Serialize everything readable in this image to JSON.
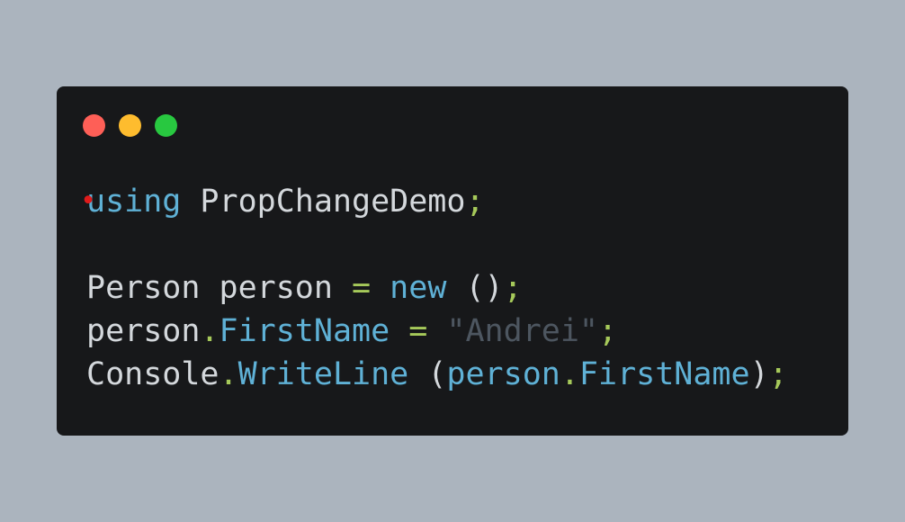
{
  "colors": {
    "background": "#abb4be",
    "window": "#17181a",
    "close": "#fe5f57",
    "minimize": "#febc2e",
    "maximize": "#28c840",
    "plain": "#d4d8dc",
    "keyword": "#5fb1d6",
    "member": "#5fb1d6",
    "punctuation": "#a6c95a",
    "string": "#4d5660",
    "error_marker": "#e01b1b"
  },
  "window": {
    "controls": [
      {
        "name": "close-button",
        "color": "#fe5f57"
      },
      {
        "name": "minimize-button",
        "color": "#febc2e"
      },
      {
        "name": "maximize-button",
        "color": "#28c840"
      }
    ]
  },
  "code": {
    "error_marker": "•",
    "lines": [
      [
        {
          "text": "using",
          "kind": "keyword"
        },
        {
          "text": " PropChangeDemo",
          "kind": "plain"
        },
        {
          "text": ";",
          "kind": "punctuation"
        }
      ],
      [],
      [
        {
          "text": "Person person ",
          "kind": "plain"
        },
        {
          "text": "=",
          "kind": "punctuation"
        },
        {
          "text": " ",
          "kind": "plain"
        },
        {
          "text": "new",
          "kind": "keyword"
        },
        {
          "text": " ()",
          "kind": "plain"
        },
        {
          "text": ";",
          "kind": "punctuation"
        }
      ],
      [
        {
          "text": "person",
          "kind": "plain"
        },
        {
          "text": ".",
          "kind": "punctuation"
        },
        {
          "text": "FirstName",
          "kind": "member"
        },
        {
          "text": " ",
          "kind": "plain"
        },
        {
          "text": "=",
          "kind": "punctuation"
        },
        {
          "text": " ",
          "kind": "plain"
        },
        {
          "text": "\"Andrei\"",
          "kind": "string"
        },
        {
          "text": ";",
          "kind": "punctuation"
        }
      ],
      [
        {
          "text": "Console",
          "kind": "plain"
        },
        {
          "text": ".",
          "kind": "punctuation"
        },
        {
          "text": "WriteLine",
          "kind": "member"
        },
        {
          "text": " (",
          "kind": "plain"
        },
        {
          "text": "person",
          "kind": "member"
        },
        {
          "text": ".",
          "kind": "punctuation"
        },
        {
          "text": "FirstName",
          "kind": "member"
        },
        {
          "text": ")",
          "kind": "plain"
        },
        {
          "text": ";",
          "kind": "punctuation"
        }
      ]
    ]
  }
}
